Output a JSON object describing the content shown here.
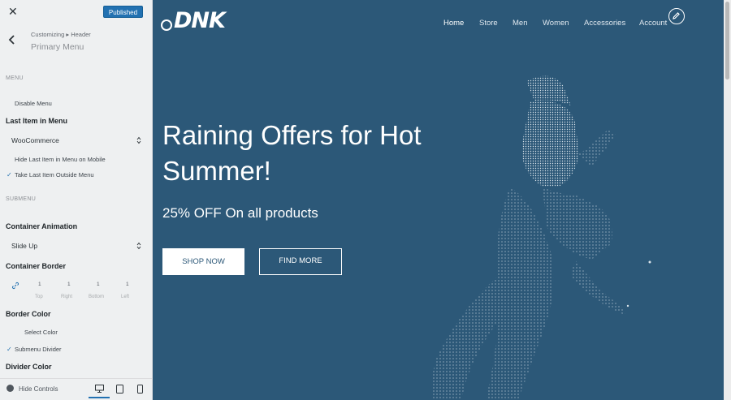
{
  "sidebar": {
    "close_glyph": "✕",
    "publish_label": "Published",
    "breadcrumb": "Customizing ▸ Header",
    "section_title": "Primary Menu",
    "menu_section_label": "MENU",
    "disable_menu_label": "Disable Menu",
    "last_item_label": "Last Item in Menu",
    "last_item_value": "WooCommerce",
    "hide_last_item_label": "Hide Last Item in Menu on Mobile",
    "take_last_item_label": "Take Last Item Outside Menu",
    "submenu_section_label": "SUBMENU",
    "container_animation_label": "Container Animation",
    "container_animation_value": "Slide Up",
    "container_border_label": "Container Border",
    "border_values": [
      "1",
      "1",
      "1",
      "1"
    ],
    "border_sides": [
      "Top",
      "Right",
      "Bottom",
      "Left"
    ],
    "border_color_label": "Border Color",
    "select_color_label": "Select Color",
    "submenu_divider_label": "Submenu Divider",
    "divider_color_label": "Divider Color",
    "hide_controls_label": "Hide Controls"
  },
  "icons": {
    "close": "close-icon",
    "back": "chevron-left-icon",
    "link": "link-icon",
    "desktop": "desktop-icon",
    "tablet": "tablet-icon",
    "mobile": "mobile-icon",
    "edit": "pencil-icon"
  },
  "preview": {
    "logo": "DNK",
    "nav": [
      "Home",
      "Store",
      "Men",
      "Women",
      "Accessories",
      "Account"
    ],
    "hero_title": "Raining Offers for Hot Summer!",
    "hero_subtitle": "25% OFF On all products",
    "shop_button": "SHOP NOW",
    "find_button": "FIND MORE"
  },
  "colors": {
    "hero_bg": "#2c5878",
    "sidebar_bg": "#eef0f1",
    "accent": "#2271b1"
  }
}
